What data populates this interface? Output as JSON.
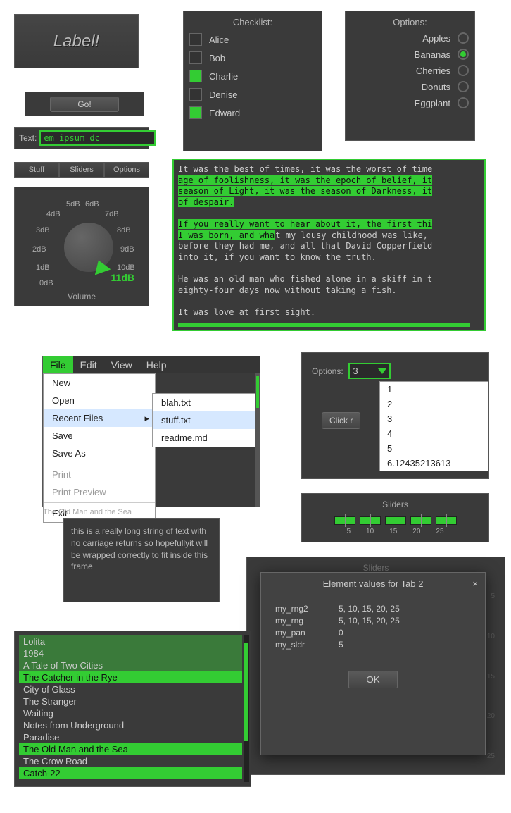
{
  "label_box": {
    "text": "Label!"
  },
  "go": {
    "label": "Go!"
  },
  "text_input": {
    "label": "Text:",
    "value": "em ipsum dc"
  },
  "tabs": {
    "items": [
      "Stuff",
      "Sliders",
      "Options"
    ]
  },
  "knob": {
    "title": "Volume",
    "value": "11dB",
    "labels": [
      "0dB",
      "1dB",
      "2dB",
      "3dB",
      "4dB",
      "5dB",
      "6dB",
      "7dB",
      "8dB",
      "9dB",
      "10dB"
    ]
  },
  "checklist": {
    "title": "Checklist:",
    "items": [
      {
        "label": "Alice",
        "checked": false
      },
      {
        "label": "Bob",
        "checked": false
      },
      {
        "label": "Charlie",
        "checked": true
      },
      {
        "label": "Denise",
        "checked": false
      },
      {
        "label": "Edward",
        "checked": true
      }
    ]
  },
  "options": {
    "title": "Options:",
    "items": [
      {
        "label": "Apples",
        "checked": false
      },
      {
        "label": "Bananas",
        "checked": true
      },
      {
        "label": "Cherries",
        "checked": false
      },
      {
        "label": "Donuts",
        "checked": false
      },
      {
        "label": "Eggplant",
        "checked": false
      }
    ]
  },
  "textarea": {
    "l1a": "It was the best of times, it was the worst of time",
    "l1b": "age of foolishness, it was the epoch of belief, it",
    "l1c": "season of Light, it was the season of Darkness, it",
    "l1d": "of despair.",
    "l2a": "If you really want to hear about it, the first thi",
    "l2b_sel": "I was born, and wha",
    "l2b_rest": "t my lousy childhood was like, ",
    "l2c": "before they had me, and all that David Copperfield",
    "l2d": "into it, if you want to know the truth.",
    "l3a": "He was an old man who fished alone in a skiff in t",
    "l3b": "eighty-four days now without taking a fish.",
    "l4": "It was love at first sight."
  },
  "menu": {
    "bar": [
      "File",
      "Edit",
      "View",
      "Help"
    ],
    "file": [
      "New",
      "Open",
      "Recent Files",
      "Save",
      "Save As",
      "Print",
      "Print Preview",
      "Exit"
    ],
    "recent": [
      "blah.txt",
      "stuff.txt",
      "readme.md"
    ],
    "peek": "The Old Man and the Sea"
  },
  "wrap": {
    "text": "this is a really long string of text with no carriage returns so hopefullyit will be wrapped correctly to fit inside this frame"
  },
  "options2": {
    "label": "Options:",
    "selected": "3",
    "items": [
      "1",
      "2",
      "3",
      "4",
      "5",
      "6.12435213613"
    ],
    "button": "Click r"
  },
  "sliders": {
    "title": "Sliders",
    "values": [
      "5",
      "10",
      "15",
      "20",
      "25"
    ]
  },
  "bg": {
    "title": "Sliders",
    "vticks": [
      "5",
      "10",
      "15",
      "20",
      "25"
    ]
  },
  "dialog": {
    "title": "Element values for Tab 2",
    "rows": [
      {
        "k": "my_rng2",
        "v": "5, 10, 15, 20, 25"
      },
      {
        "k": "my_rng",
        "v": "5, 10, 15, 20, 25"
      },
      {
        "k": "my_pan",
        "v": "0"
      },
      {
        "k": "my_sldr",
        "v": "5"
      }
    ],
    "ok": "OK"
  },
  "listbox": {
    "items": [
      {
        "t": "Lolita",
        "s": 1
      },
      {
        "t": "1984",
        "s": 1
      },
      {
        "t": "A Tale of Two Cities",
        "s": 1
      },
      {
        "t": "The Catcher in the Rye",
        "s": 2
      },
      {
        "t": "City of Glass",
        "s": 0
      },
      {
        "t": "The Stranger",
        "s": 0
      },
      {
        "t": "Waiting",
        "s": 0
      },
      {
        "t": "Notes from Underground",
        "s": 0
      },
      {
        "t": "Paradise",
        "s": 0
      },
      {
        "t": "The Old Man and the Sea",
        "s": 2
      },
      {
        "t": "The Crow Road",
        "s": 0
      },
      {
        "t": "Catch-22",
        "s": 2
      }
    ]
  }
}
